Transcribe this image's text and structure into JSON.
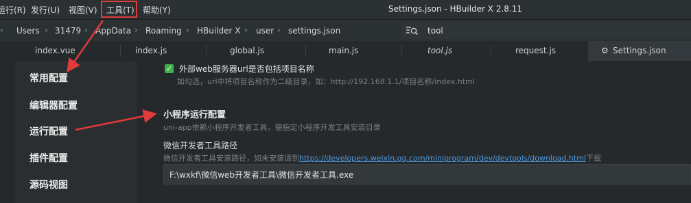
{
  "menu": {
    "items": [
      "运行(R)",
      "发行(U)",
      "视图(V)",
      "工具(T)",
      "帮助(Y)"
    ]
  },
  "window_title": "Settings.json - HBuilder X 2.8.11",
  "breadcrumb": [
    "Users",
    "31479",
    "AppData",
    "Roaming",
    "HBuilder X",
    "user",
    "settings.json"
  ],
  "search": {
    "value": "tool",
    "icon": "search-list-icon"
  },
  "tabs": [
    {
      "label": "index.vue"
    },
    {
      "label": "index.js"
    },
    {
      "label": "global.js"
    },
    {
      "label": "main.js"
    },
    {
      "label": "tool.js"
    },
    {
      "label": "request.js"
    },
    {
      "label": "Settings.json",
      "icon": "gear-icon",
      "active": true
    }
  ],
  "sidebar": {
    "items": [
      "常用配置",
      "编辑器配置",
      "运行配置",
      "插件配置",
      "源码视图"
    ]
  },
  "settings": {
    "external_server": {
      "checked": true,
      "label": "外部web服务器url是否包括项目名称",
      "description": "如勾选，url中将项目名称作为二级目录，如：http://192.168.1.1/项目名称/index.html"
    },
    "section": {
      "title": "小程序运行配置",
      "description": "uni-app依赖小程序开发者工具，需指定小程序开发工具安装目录"
    },
    "wechat_path": {
      "label": "微信开发者工具路径",
      "description_prefix": "微信开发者工具安装路径，如未安装请到",
      "link": "https://developers.weixin.qq.com/miniprogram/dev/devtools/download.html",
      "description_suffix": "下载",
      "value": "F:\\wxkf\\微信web开发者工具\\微信开发者工具.exe"
    }
  },
  "annotation_color": "#e03b3b",
  "check_color": "#3fb24b"
}
